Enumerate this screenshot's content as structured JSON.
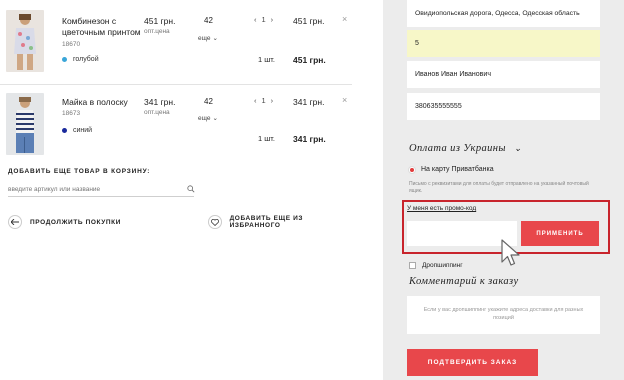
{
  "cart": {
    "items": [
      {
        "name": "Комбинезон с цветочным принтом",
        "sku": "18670",
        "color_name": "голубой",
        "color_hex": "#3aa6d8",
        "price": "451 грн.",
        "price_sub": "опт.цена",
        "size": "42",
        "size_select": "еще",
        "qty": "1",
        "qty_text": "1 шт.",
        "total": "451 грн.",
        "total_final": "451 грн."
      },
      {
        "name": "Майка в полоску",
        "sku": "18673",
        "color_name": "синий",
        "color_hex": "#1a2a9c",
        "price": "341 грн.",
        "price_sub": "опт.цена",
        "size": "42",
        "size_select": "еще",
        "qty": "1",
        "qty_text": "1 шт.",
        "total": "341 грн.",
        "total_final": "341 грн."
      }
    ],
    "qty_minus": "‹",
    "qty_plus": "›",
    "remove": "×"
  },
  "add_item": {
    "title": "ДОБАВИТЬ ЕЩЕ ТОВАР В КОРЗИНУ:",
    "placeholder": "введите артикул или название"
  },
  "nav": {
    "continue_label": "ПРОДОЛЖИТЬ ПОКУПКИ",
    "favorites_label": "ДОБАВИТЬ ЕЩЕ ИЗ ИЗБРАННОГО"
  },
  "delivery": {
    "address": "Овидиопольская дорога, Одесса, Одесская область",
    "number": "5",
    "recipient": "Иванов Иван Иванович",
    "phone": "380635555555"
  },
  "payment": {
    "title": "Оплата из Украины",
    "option_label": "На карту Приватбанка",
    "note": "Письмо с реквизитами для оплаты будет отправлено на указанный почтовый ящик."
  },
  "promo": {
    "link_label": "У меня есть промо-код",
    "input_value": "",
    "apply_label": "ПРИМЕНИТЬ"
  },
  "dropshipping": {
    "label": "Дропшиппинг"
  },
  "comment": {
    "title": "Комментарий к заказу",
    "placeholder": "Если у вас дропшиппинг укажите адреса доставки для разных позиций"
  },
  "confirm": {
    "label": "ПОДТВЕРДИТЬ ЗАКАЗ"
  },
  "colors": {
    "accent": "#e8474b",
    "highlight_border": "#c8242c",
    "panel_bg": "#ececec",
    "field_yellow": "#f7f7c8"
  }
}
